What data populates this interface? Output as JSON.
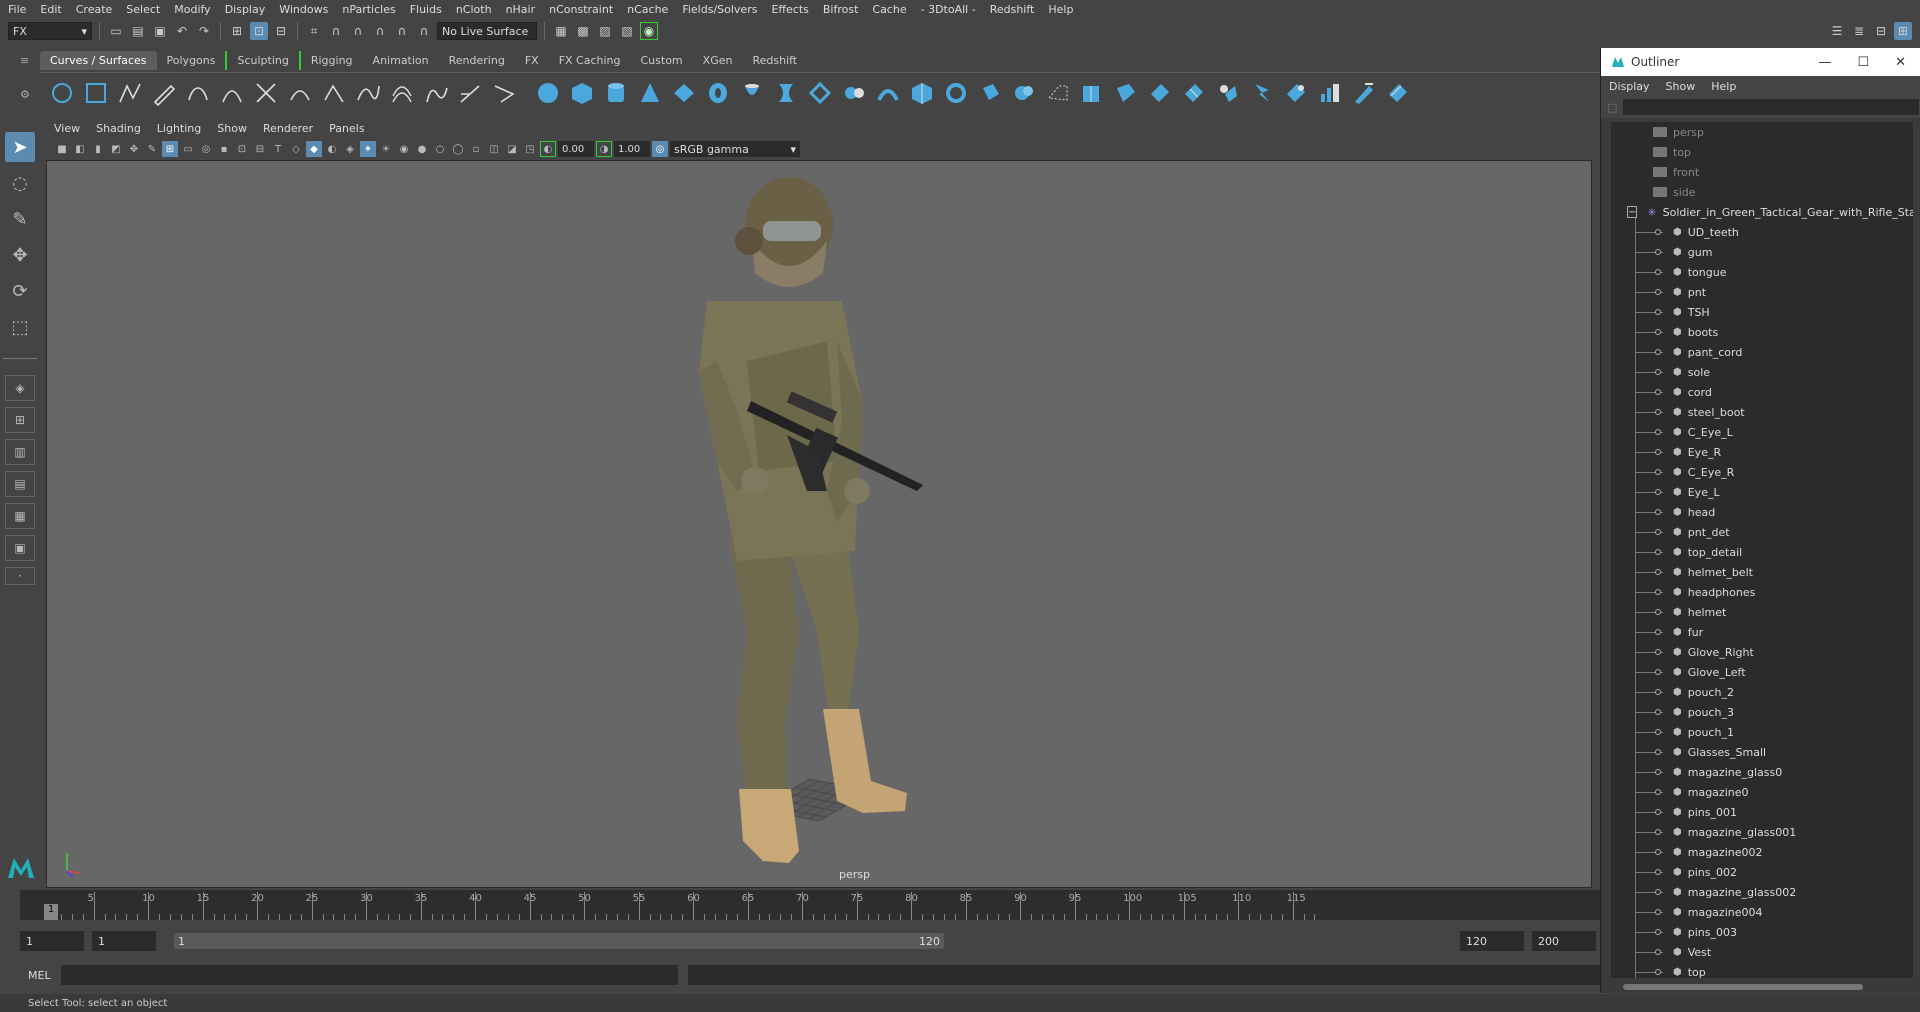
{
  "menubar": [
    "File",
    "Edit",
    "Create",
    "Select",
    "Modify",
    "Display",
    "Windows",
    "nParticles",
    "Fluids",
    "nCloth",
    "nHair",
    "nConstraint",
    "nCache",
    "Fields/Solvers",
    "Effects",
    "Bifrost",
    "Cache",
    "- 3DtoAll -",
    "Redshift",
    "Help"
  ],
  "status": {
    "mode": "FX",
    "live_surface": "No Live Surface"
  },
  "shelf_tabs": [
    "Curves / Surfaces",
    "Polygons",
    "Sculpting",
    "Rigging",
    "Animation",
    "Rendering",
    "FX",
    "FX Caching",
    "Custom",
    "XGen",
    "Redshift"
  ],
  "viewport": {
    "menu": [
      "View",
      "Shading",
      "Lighting",
      "Show",
      "Renderer",
      "Panels"
    ],
    "exposure": "0.00",
    "gamma": "1.00",
    "colorspace": "sRGB gamma",
    "camera": "persp"
  },
  "timeline": {
    "ticks": [
      "5",
      "10",
      "15",
      "20",
      "25",
      "30",
      "35",
      "40",
      "45",
      "50",
      "55",
      "60",
      "65",
      "70",
      "75",
      "80",
      "85",
      "90",
      "95",
      "100",
      "105",
      "110",
      "115"
    ],
    "current": "1"
  },
  "range": {
    "start": "1",
    "playstart": "1",
    "slider_start": "1",
    "slider_end": "120",
    "playend": "120",
    "end": "200"
  },
  "cmd": {
    "label": "MEL"
  },
  "helpline": "Select Tool: select an object",
  "outliner": {
    "title": "Outliner",
    "menu": [
      "Display",
      "Show",
      "Help"
    ],
    "cameras": [
      "persp",
      "top",
      "front",
      "side"
    ],
    "root": "Soldier_in_Green_Tactical_Gear_with_Rifle_Stanc",
    "children": [
      "UD_teeth",
      "gum",
      "tongue",
      "pnt",
      "TSH",
      "boots",
      "pant_cord",
      "sole",
      "cord",
      "steel_boot",
      "C_Eye_L",
      "Eye_R",
      "C_Eye_R",
      "Eye_L",
      "head",
      "pnt_det",
      "top_detail",
      "helmet_belt",
      "headphones",
      "helmet",
      "fur",
      "Glove_Right",
      "Glove_Left",
      "pouch_2",
      "pouch_3",
      "pouch_1",
      "Glasses_Small",
      "magazine_glass0",
      "magazine0",
      "pins_001",
      "magazine_glass001",
      "magazine002",
      "pins_002",
      "magazine_glass002",
      "magazine004",
      "pins_003",
      "Vest",
      "top"
    ]
  },
  "colors": {
    "accent": "#5b8bb0",
    "shelf_icon": "#4aa8dc"
  }
}
